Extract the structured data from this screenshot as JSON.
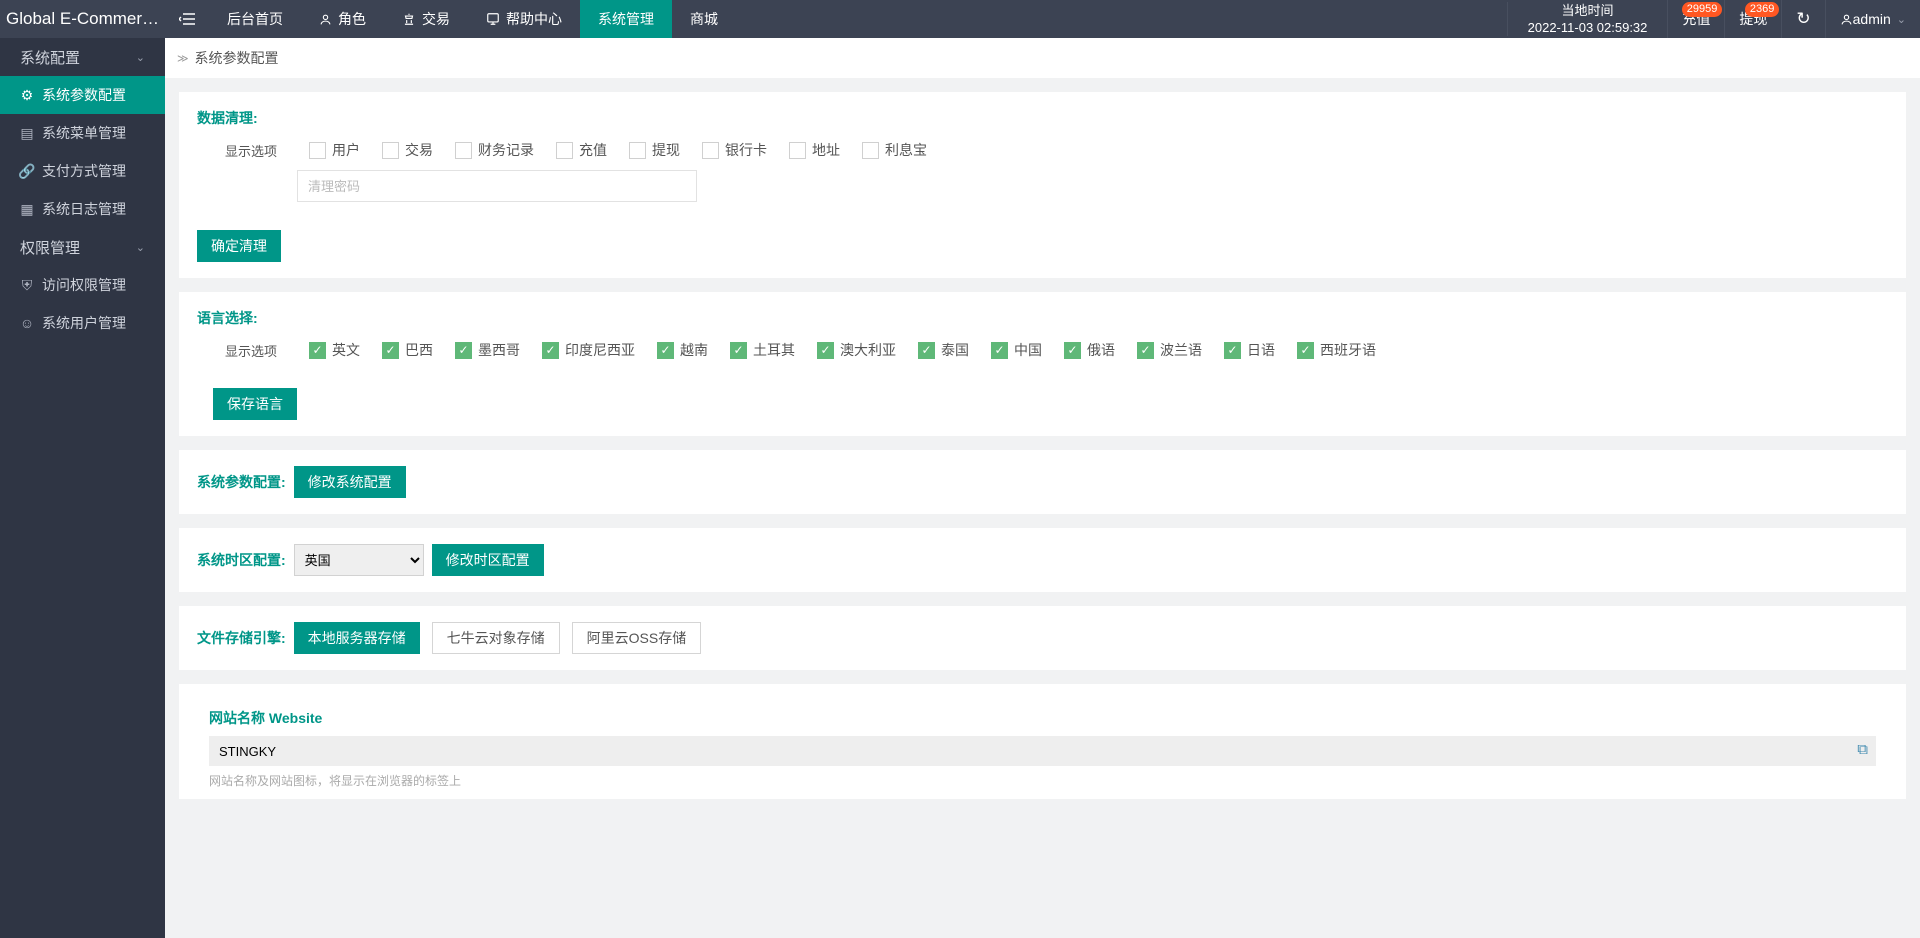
{
  "brand": "Global E-Commerce...",
  "topnav": [
    "后台首页",
    "角色",
    "交易",
    "帮助中心",
    "系统管理",
    "商城"
  ],
  "topnav_active": 4,
  "time": {
    "label": "当地时间",
    "value": "2022-11-03 02:59:32"
  },
  "recharge": {
    "label": "充值",
    "badge": "29959"
  },
  "withdraw": {
    "label": "提现",
    "badge": "2369"
  },
  "user": "admin",
  "sidebar": {
    "group1": "系统配置",
    "items1": [
      "系统参数配置",
      "系统菜单管理",
      "支付方式管理",
      "系统日志管理"
    ],
    "group2": "权限管理",
    "items2": [
      "访问权限管理",
      "系统用户管理"
    ]
  },
  "breadcrumb": "系统参数配置",
  "sec_clean": {
    "title": "数据清理:",
    "label": "显示选项",
    "options": [
      "用户",
      "交易",
      "财务记录",
      "充值",
      "提现",
      "银行卡",
      "地址",
      "利息宝"
    ],
    "placeholder": "清理密码",
    "btn": "确定清理"
  },
  "sec_lang": {
    "title": "语言选择:",
    "label": "显示选项",
    "options": [
      "英文",
      "巴西",
      "墨西哥",
      "印度尼西亚",
      "越南",
      "土耳其",
      "澳大利亚",
      "泰国",
      "中国",
      "俄语",
      "波兰语",
      "日语",
      "西班牙语"
    ],
    "btn": "保存语言"
  },
  "sec_param": {
    "title": "系统参数配置:",
    "btn": "修改系统配置"
  },
  "sec_tz": {
    "title": "系统时区配置:",
    "selected": "英国",
    "btn": "修改时区配置"
  },
  "sec_storage": {
    "title": "文件存储引擎:",
    "btns": [
      "本地服务器存储",
      "七牛云对象存储",
      "阿里云OSS存储"
    ],
    "active": 0
  },
  "sec_site": {
    "label": "网站名称 Website",
    "value": "STINGKY",
    "help": "网站名称及网站图标，将显示在浏览器的标签上"
  }
}
